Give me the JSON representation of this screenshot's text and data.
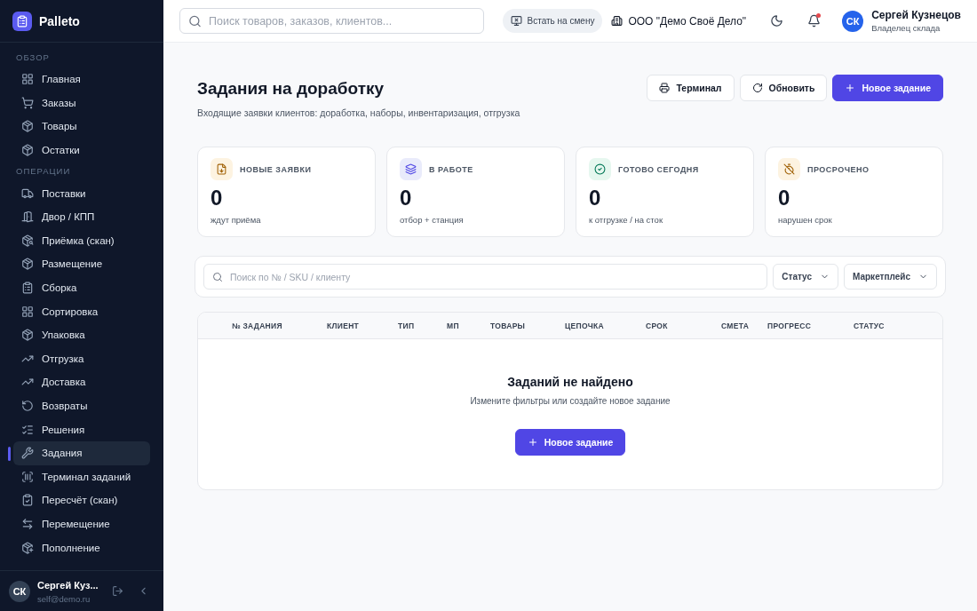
{
  "brand": {
    "name": "Palleto"
  },
  "sidebar": {
    "sections": [
      {
        "title": "ОБЗОР",
        "items": [
          {
            "label": "Главная",
            "selected": false
          },
          {
            "label": "Заказы",
            "selected": false
          },
          {
            "label": "Товары",
            "selected": false
          },
          {
            "label": "Остатки",
            "selected": false
          }
        ]
      },
      {
        "title": "ОПЕРАЦИИ",
        "items": [
          {
            "label": "Поставки",
            "selected": false
          },
          {
            "label": "Двор / КПП",
            "selected": false
          },
          {
            "label": "Приёмка (скан)",
            "selected": false
          },
          {
            "label": "Размещение",
            "selected": false
          },
          {
            "label": "Сборка",
            "selected": false
          },
          {
            "label": "Сортировка",
            "selected": false
          },
          {
            "label": "Упаковка",
            "selected": false
          },
          {
            "label": "Отгрузка",
            "selected": false
          },
          {
            "label": "Доставка",
            "selected": false
          },
          {
            "label": "Возвраты",
            "selected": false
          },
          {
            "label": "Решения",
            "selected": false
          },
          {
            "label": "Задания",
            "selected": true
          },
          {
            "label": "Терминал заданий",
            "selected": false
          },
          {
            "label": "Пересчёт (скан)",
            "selected": false
          },
          {
            "label": "Перемещение",
            "selected": false
          },
          {
            "label": "Пополнение",
            "selected": false
          }
        ]
      }
    ],
    "user": {
      "initials": "СК",
      "name": "Сергей Куз...",
      "email": "self@demo.ru"
    }
  },
  "topbar": {
    "search": {
      "placeholder": "Поиск товаров, заказов, клиентов..."
    },
    "shift_button": "Встать на смену",
    "company": "ООО \"Демо Своё Дело\"",
    "notifications_unread": true,
    "user": {
      "initials": "СК",
      "name": "Сергей Кузнецов",
      "role": "Владелец склада"
    }
  },
  "page": {
    "title": "Задания на доработку",
    "subtitle": "Входящие заявки клиентов: доработка, наборы, инвентаризация, отгрузка",
    "actions": [
      {
        "label": "Терминал",
        "kind": "secondary"
      },
      {
        "label": "Обновить",
        "kind": "secondary"
      },
      {
        "label": "Новое задание",
        "kind": "primary"
      }
    ]
  },
  "stats": [
    {
      "title": "НОВЫЕ ЗАЯВКИ",
      "value": "0",
      "caption": "ждут приёма",
      "color": "#fdf3e1"
    },
    {
      "title": "В РАБОТЕ",
      "value": "0",
      "caption": "отбор + станция",
      "color": "#e9ebfb"
    },
    {
      "title": "ГОТОВО СЕГОДНЯ",
      "value": "0",
      "caption": "к отгрузке / на сток",
      "color": "#e6f7ef"
    },
    {
      "title": "ПРОСРОЧЕНО",
      "value": "0",
      "caption": "нарушен срок",
      "color": "#fdf3e1"
    }
  ],
  "filters": {
    "search": {
      "placeholder": "Поиск по № / SKU / клиенту"
    },
    "dropdowns": [
      "Статус",
      "Маркетплейс"
    ]
  },
  "table": {
    "columns": [
      "№ ЗАДАНИЯ",
      "КЛИЕНТ",
      "ТИП",
      "МП",
      "ТОВАРЫ",
      "ЦЕПОЧКА",
      "СРОК",
      "СМЕТА",
      "ПРОГРЕСС",
      "СТАТУС"
    ],
    "empty": {
      "title": "Заданий не найдено",
      "text": "Измените фильтры или создайте новое задание",
      "button": "Новое задание"
    }
  }
}
